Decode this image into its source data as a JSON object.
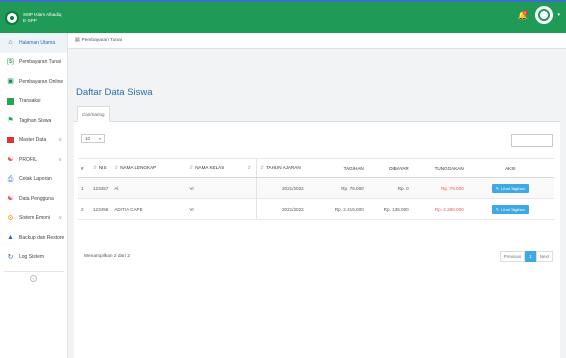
{
  "header": {
    "brand_line1": "SMP Islam Albadiq",
    "brand_line2": "E-SPP",
    "notif_count": "0"
  },
  "sidebar": {
    "items": [
      {
        "label": "Halaman Utama",
        "icon": "home-icon",
        "arrow": false
      },
      {
        "label": "Pembayaran Tunai",
        "icon": "cash-icon",
        "arrow": false
      },
      {
        "label": "Pembayaran Online",
        "icon": "card-icon",
        "arrow": true
      },
      {
        "label": "Transaksi",
        "icon": "book-icon",
        "arrow": false
      },
      {
        "label": "Tagihan Siswa",
        "icon": "tag-icon",
        "arrow": false
      },
      {
        "label": "Master Data",
        "icon": "folder-icon",
        "arrow": true
      },
      {
        "label": "PROFIL",
        "icon": "users-icon",
        "arrow": true
      },
      {
        "label": "Cetak Laporan",
        "icon": "print-icon",
        "arrow": false
      },
      {
        "label": "Data Pengguna",
        "icon": "users-icon",
        "arrow": false
      },
      {
        "label": "Sistem Emoni",
        "icon": "gear-icon",
        "arrow": true
      },
      {
        "label": "Backup dan Restore",
        "icon": "backup-icon",
        "arrow": false
      },
      {
        "label": "Log Sistem",
        "icon": "history-icon",
        "arrow": false
      }
    ]
  },
  "breadcrumb": {
    "label": "Pembayaran Tunai"
  },
  "main": {
    "title": "Daftar Data Siswa",
    "tab_label": "Cari/Saring",
    "length_value": "10"
  },
  "table": {
    "columns": [
      "#",
      "NIS",
      "NAMA LENGKAP",
      "NAMA KELAS",
      "",
      "TAHUN AJARAN",
      "TAGIHAN",
      "DIBAYAR",
      "TUNGGAKAN",
      "AKSI"
    ],
    "rows": [
      {
        "no": "1",
        "nis": "123457",
        "nama": "Al",
        "kelas": "VI",
        "extra": "",
        "tahun": "2021/2022",
        "tagihan": "Rp. 75.000",
        "dibayar": "Rp. 0",
        "tunggakan": "Rp. 75.000",
        "aksi": "Lihat Tagihan"
      },
      {
        "no": "2",
        "nis": "123456",
        "nama": "ADITIA CAPE",
        "kelas": "VI",
        "extra": "",
        "tahun": "2021/2022",
        "tagihan": "Rp. 2.415.000",
        "dibayar": "Rp. 135.000",
        "tunggakan": "Rp. 2.280.000",
        "aksi": "Lihat Tagihan"
      }
    ]
  },
  "footer": {
    "info": "Menampilkan 2 dari 2",
    "prev": "Previous",
    "page": "1",
    "next": "Next"
  },
  "colors": {
    "topbar": "#1f9a57",
    "accent": "#3fa9e4",
    "title": "#2b6da5",
    "debt": "#e55555"
  }
}
